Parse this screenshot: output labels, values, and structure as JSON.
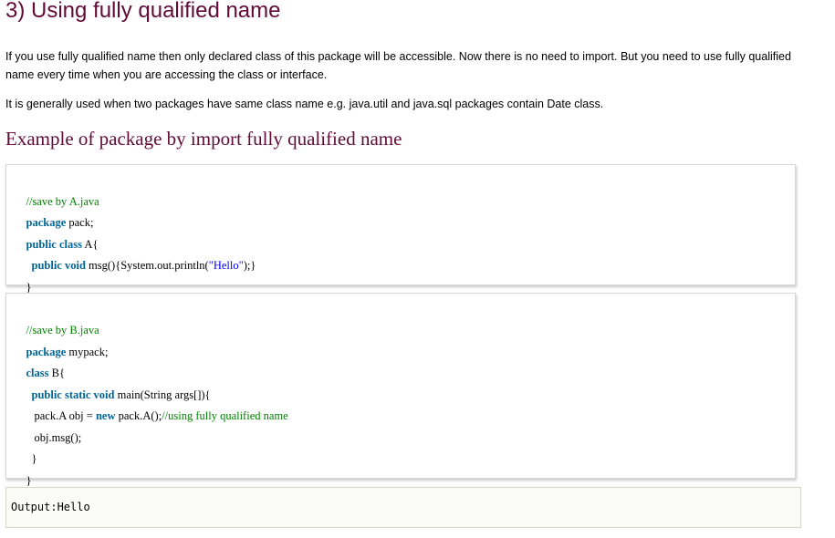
{
  "heading": "3) Using fully qualified name",
  "paragraphs": [
    "If you use fully qualified name then only declared class of this package will be accessible. Now there is no need to import. But you need to use fully qualified name every time when you are accessing the class or interface.",
    "It is generally used when two packages have same class name e.g. java.util and java.sql packages contain Date class."
  ],
  "subheading": "Example of package by import fully qualified name",
  "code_a": {
    "comment": "//save by A.java",
    "kw_package": "package",
    "package_name": " pack;",
    "kw_public_class": "public class",
    "class_decl": " A{",
    "kw_public_void": "public void",
    "method_start": " msg(){System.out.println(",
    "string": "\"Hello\"",
    "method_end": ");}",
    "close": "}"
  },
  "code_b": {
    "comment": "//save by B.java",
    "kw_package": "package",
    "package_name": " mypack;",
    "kw_class": "class",
    "class_decl": " B{",
    "kw_public_static_void": "public static void",
    "main_decl": " main(String args[]){",
    "obj_decl": "pack.A obj = ",
    "kw_new": "new",
    "obj_ctor": " pack.A();",
    "inline_comment": "//using fully qualified name",
    "call": "obj.msg();",
    "close_inner": "}",
    "close_outer": "}"
  },
  "output": "Output:Hello"
}
